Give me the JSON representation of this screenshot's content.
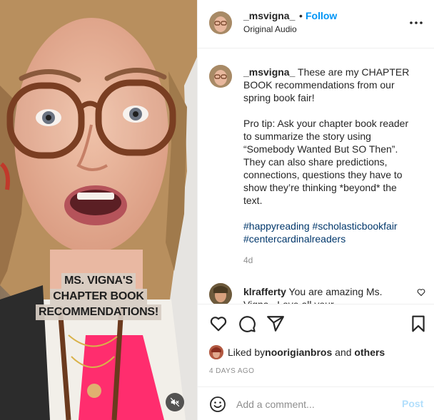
{
  "colors": {
    "follow": "#0095f6",
    "hashtag": "#00376b",
    "muted_text": "#8e8e8e",
    "post_disabled": "#b2dffc"
  },
  "media": {
    "overlay_lines": [
      "MS. VIGNA'S",
      "CHAPTER BOOK",
      "RECOMMENDATIONS!"
    ],
    "mute_icon": "speaker-muted-icon"
  },
  "header": {
    "username": "_msvigna_",
    "separator": "•",
    "follow_label": "Follow",
    "audio_label": "Original Audio",
    "more_icon": "more-options-icon"
  },
  "caption": {
    "username": "_msvigna_",
    "text1": " These are my CHAPTER BOOK recommendations from our spring book fair!",
    "text2": "Pro tip: Ask your chapter book reader to summarize the story using “Somebody Wanted But SO Then”. They can also share predictions, connections, questions they have to show they’re thinking *beyond* the text.",
    "hashtags": [
      "#happyreading",
      "#scholasticbookfair",
      "#centercardinalreaders"
    ],
    "time": "4d"
  },
  "comments": [
    {
      "username": "klrafferty",
      "text": " You are amazing Ms. Vigna . Love all your"
    }
  ],
  "actions": {
    "like_icon": "heart-icon",
    "comment_icon": "comment-icon",
    "share_icon": "share-icon",
    "save_icon": "bookmark-icon"
  },
  "likes": {
    "prefix": "Liked by ",
    "user": "noorigianbros",
    "middle": " and ",
    "others": "others"
  },
  "post_date": "4 DAYS AGO",
  "add_comment": {
    "placeholder": "Add a comment...",
    "post_label": "Post",
    "emoji_icon": "emoji-icon"
  }
}
